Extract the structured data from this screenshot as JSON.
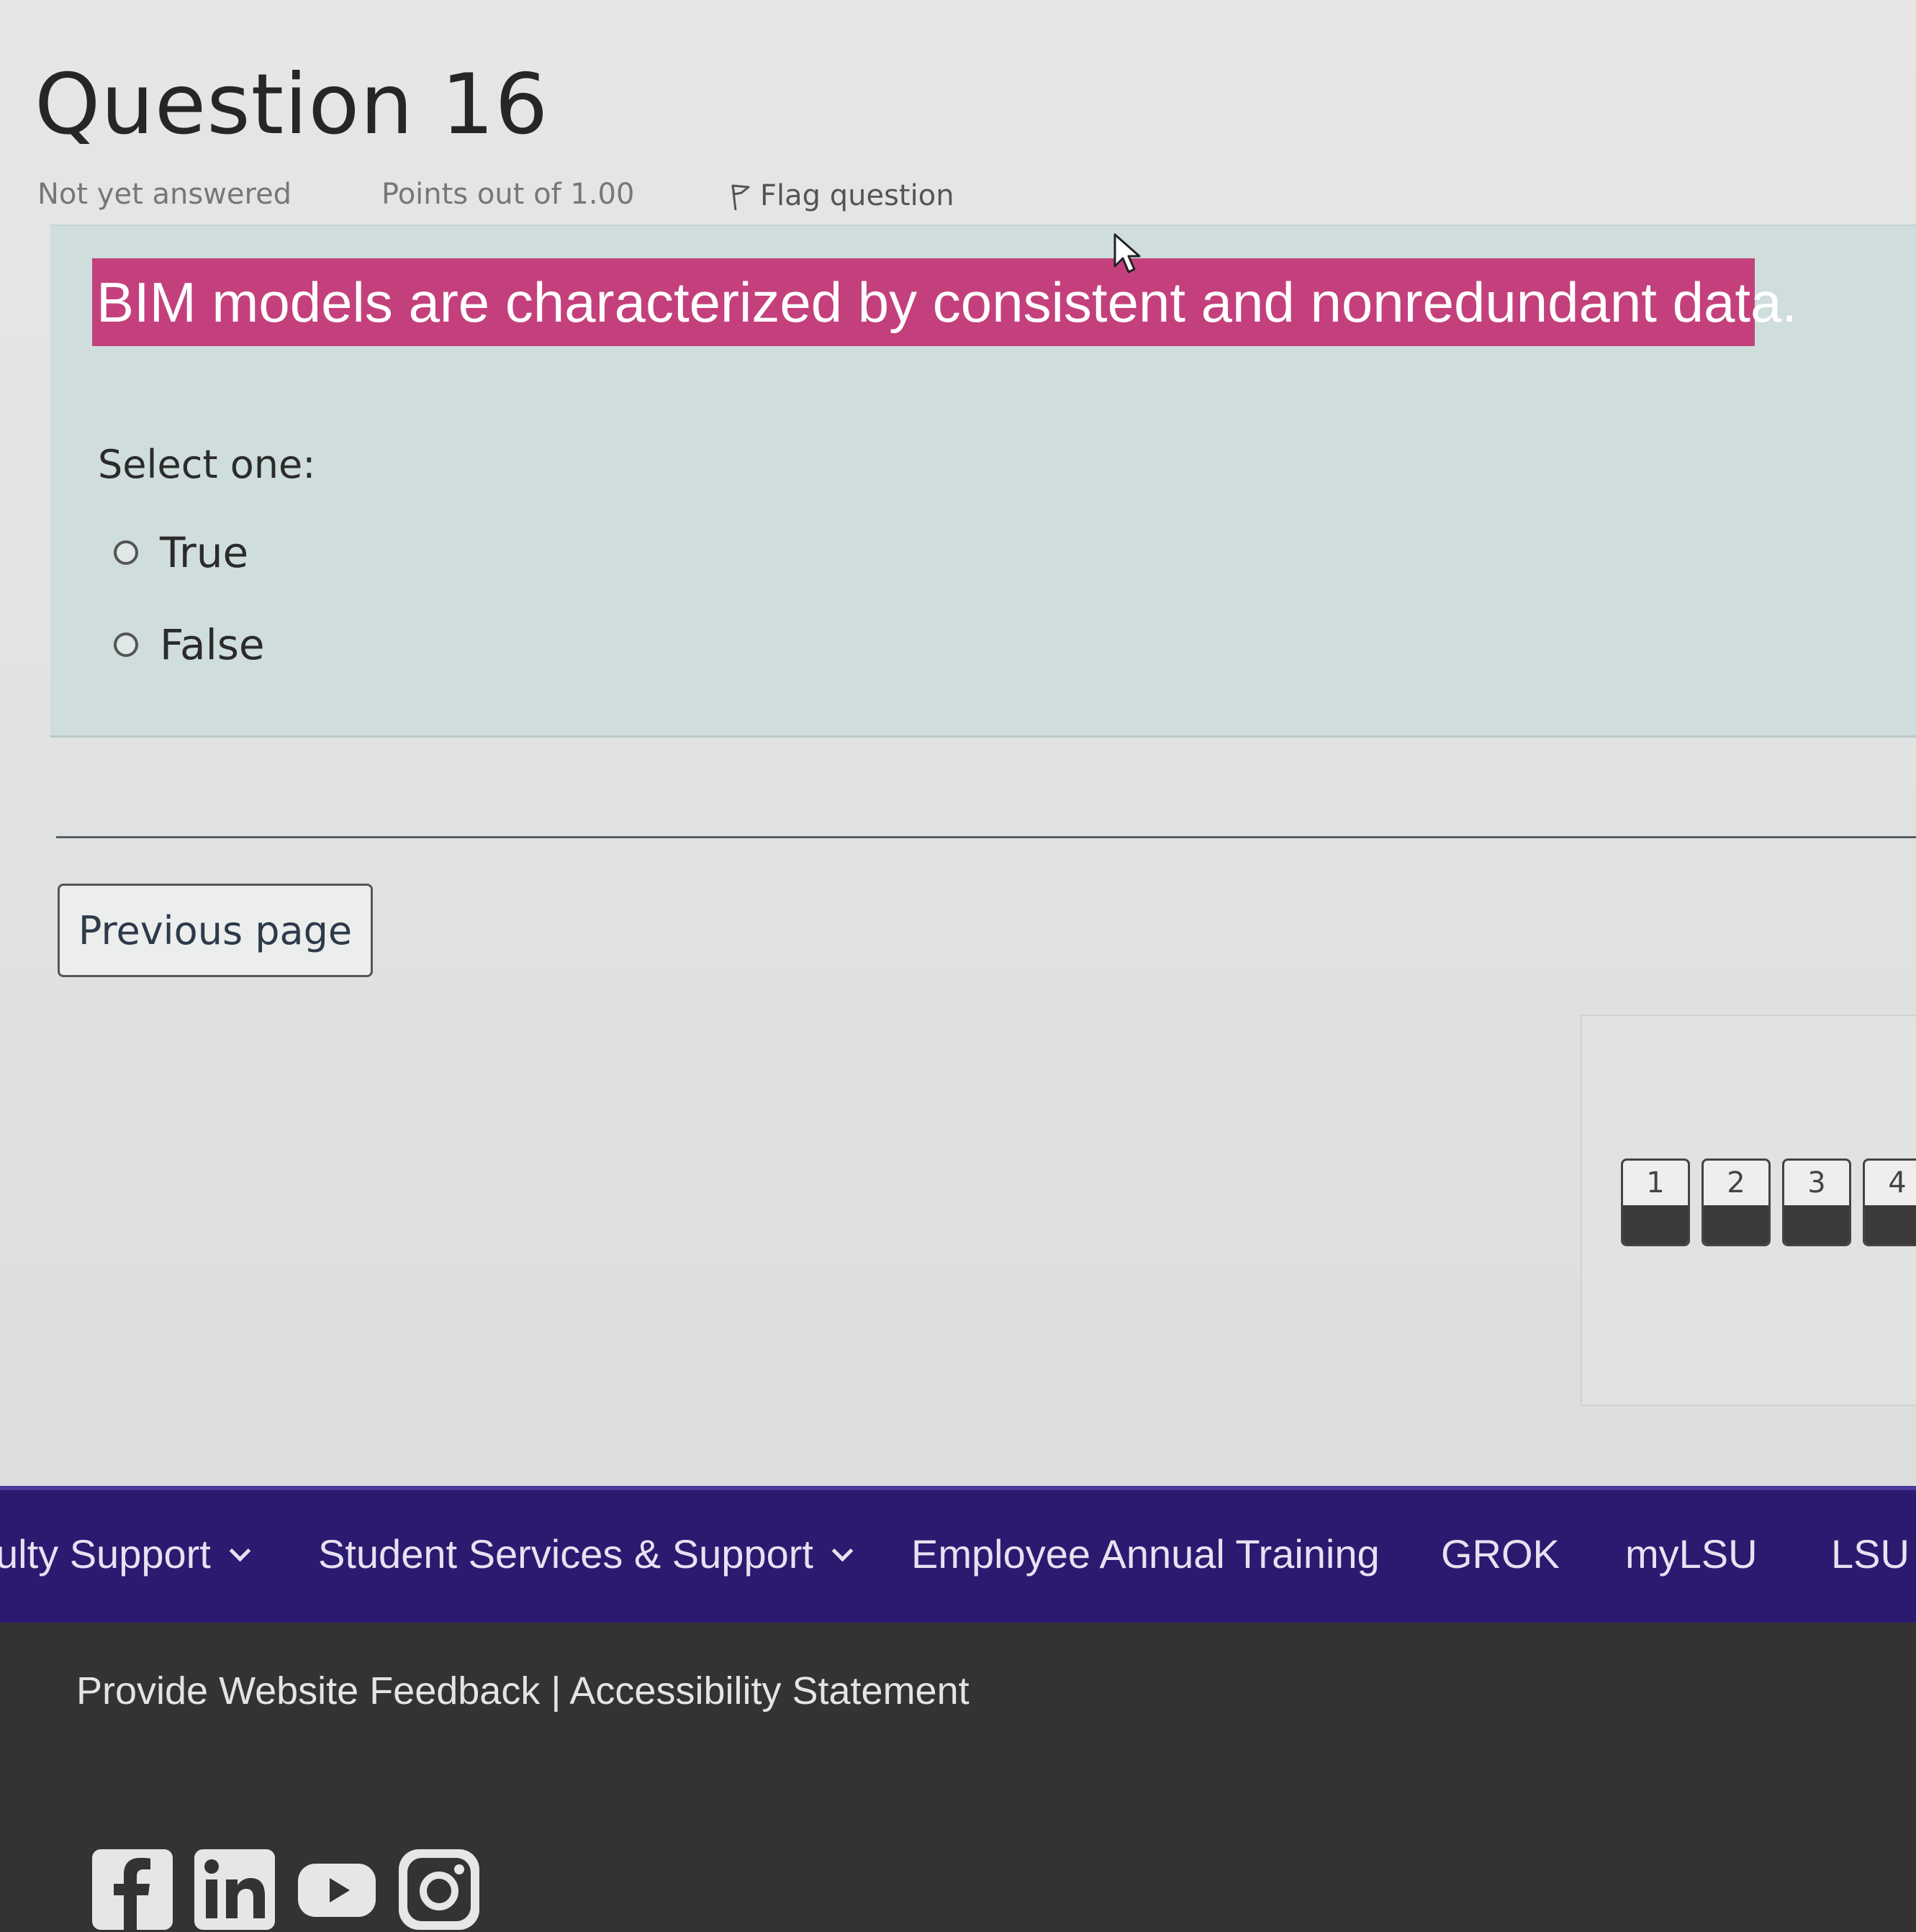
{
  "question": {
    "title": "Question 16",
    "status": "Not yet answered",
    "points": "Points out of 1.00",
    "flag_label": "Flag question",
    "text": "BIM models are characterized by consistent and nonredundant data.",
    "prompt": "Select one:",
    "options": [
      {
        "label": "True",
        "selected": false
      },
      {
        "label": "False",
        "selected": false
      }
    ]
  },
  "navigation": {
    "previous_label": "Previous page"
  },
  "quiz_nav": {
    "buttons": [
      "1",
      "2",
      "3",
      "4"
    ]
  },
  "menu_bar": {
    "items": [
      {
        "label": "ulty Support",
        "has_dropdown": true
      },
      {
        "label": "Student Services & Support",
        "has_dropdown": true
      },
      {
        "label": "Employee Annual Training",
        "has_dropdown": false
      },
      {
        "label": "GROK",
        "has_dropdown": false
      },
      {
        "label": "myLSU",
        "has_dropdown": false
      },
      {
        "label": "LSU I",
        "has_dropdown": false
      }
    ]
  },
  "footer": {
    "feedback": "Provide Website Feedback",
    "separator": " | ",
    "accessibility": "Accessibility Statement",
    "social": [
      "facebook-icon",
      "linkedin-icon",
      "youtube-icon",
      "instagram-icon"
    ]
  },
  "colors": {
    "highlight": "#c4407c",
    "question_bg": "#cfdddc",
    "menu_bar": "#2b1a70",
    "footer": "#333333"
  }
}
